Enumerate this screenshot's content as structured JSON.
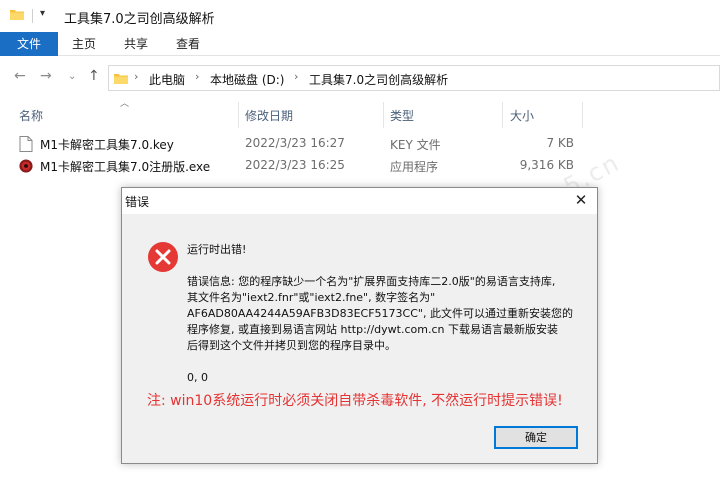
{
  "window": {
    "title": "工具集7.0之司创高级解析",
    "quick_access_dropdown": "▾"
  },
  "ribbon": {
    "tabs": [
      {
        "label": "文件",
        "active": true
      },
      {
        "label": "主页"
      },
      {
        "label": "共享"
      },
      {
        "label": "查看"
      }
    ]
  },
  "navigation": {
    "back": "←",
    "forward": "→",
    "history": "⌄",
    "up": "↑",
    "breadcrumbs": [
      "此电脑",
      "本地磁盘 (D:)",
      "工具集7.0之司创高级解析"
    ],
    "separator": "›"
  },
  "columns": {
    "name": "名称",
    "date": "修改日期",
    "type": "类型",
    "size": "大小"
  },
  "files": [
    {
      "name": "M1卡解密工具集7.0.key",
      "date": "2022/3/23 16:27",
      "type": "KEY 文件",
      "size": "7 KB",
      "icon": "file-icon"
    },
    {
      "name": "M1卡解密工具集7.0注册版.exe",
      "date": "2022/3/23 16:25",
      "type": "应用程序",
      "size": "9,316 KB",
      "icon": "exe-icon"
    }
  ],
  "watermark": "www.admin5.cn",
  "dialog": {
    "title": "错误",
    "close": "✕",
    "message_title": "运行时出错!",
    "message_lines": [
      "错误信息: 您的程序缺少一个名为\"扩展界面支持库二2.0版\"的易语言支持库,",
      "其文件名为\"iext2.fnr\"或\"iext2.fne\", 数字签名为\"",
      "AF6AD80AA4244A59AFB3D83ECF5173CC\", 此文件可以通过重新安装您的",
      "程序修复, 或直接到易语言网站 http://dywt.com.cn 下载易语言最新版安装",
      "后得到这个文件并拷贝到您的程序目录中。"
    ],
    "code": "0, 0",
    "note": "注: win10系统运行时必须关闭自带杀毒软件, 不然运行时提示错误!",
    "ok_label": "确定"
  },
  "colors": {
    "file_tab": "#1a6fc5",
    "note_red": "#e53232",
    "error_red": "#e53935",
    "folder_yellow": "#f5c542"
  }
}
